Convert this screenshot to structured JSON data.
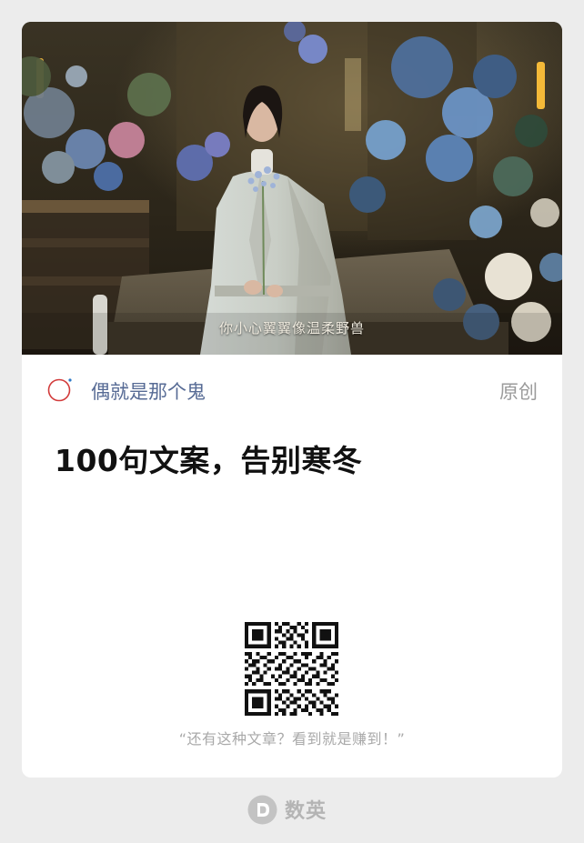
{
  "cover": {
    "subtitle": "你小心翼翼像温柔野兽"
  },
  "author": {
    "name": "偶就是那个鬼",
    "tag": "原创"
  },
  "article": {
    "title": "100句文案，告别寒冬"
  },
  "share": {
    "slogan": "“还有这种文章？看到就是赚到！”"
  },
  "footer": {
    "brand": "数英"
  },
  "icons": {
    "author": "circle-logo-icon",
    "brand": "shuying-logo-icon",
    "qr": "qr-code"
  },
  "colors": {
    "author_name": "#576b95",
    "author_icon": "#d23b3b",
    "tag": "#9b9b9b",
    "title": "#111111",
    "slogan": "#a9a9a9",
    "page_bg": "#ececec"
  }
}
